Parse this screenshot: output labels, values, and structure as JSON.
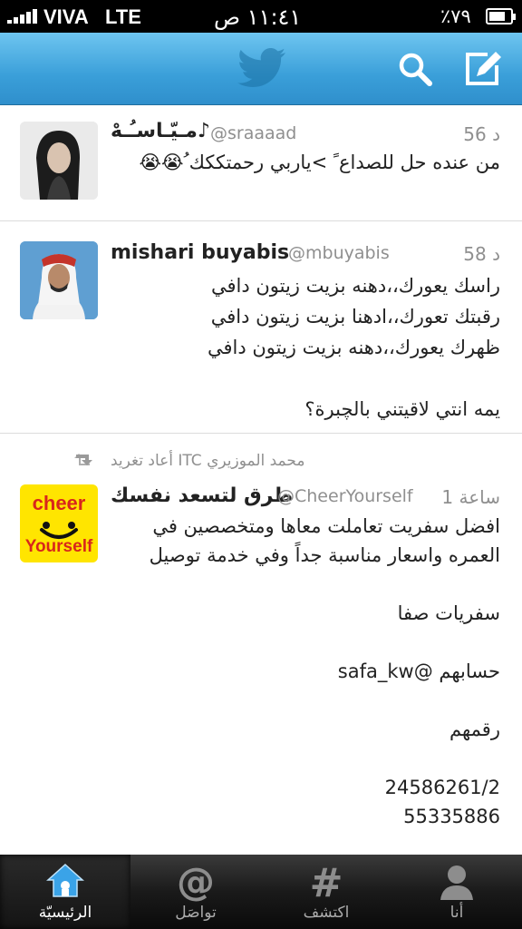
{
  "status_bar": {
    "carrier": "VIVA",
    "network": "LTE",
    "time": "١١:٤١ ص",
    "battery": "٪٧٩",
    "battery_level": 0.79
  },
  "nav": {
    "logo_icon": "twitter-bird-icon",
    "search_icon": "search-icon",
    "compose_icon": "compose-icon",
    "bar_color": "#3a9fd9"
  },
  "tweets": [
    {
      "time": "56 د",
      "name": "مـيّـاسـُـهْ♪",
      "handle": "@sraaaad",
      "text": "من عنده حل للصداع ً >ياربي رحمتككك ُ😭😭"
    },
    {
      "time": "58 د",
      "name": "mishari buyabis",
      "handle": "@mbuyabis",
      "text": "راسك يعورك،،دهنه بزيت زيتون دافي\nرقبتك تعورك،،ادهنا بزيت زيتون دافي\nظهرك يعورك،،دهنه بزيت زيتون دافي\n\nيمه انتي لاقيتني بالچبرة؟"
    },
    {
      "retweet_by": "محمد الموزيري ITC أعاد تغريد",
      "time": "1 ساعة",
      "name": "طرق لتسعد نفسك",
      "handle": "@CheerYourself",
      "avatar_text_top": "cheer",
      "avatar_text_bottom": "Yourself",
      "text": "افضل سفريت تعاملت معاها ومتخصصين في\nالعمره واسعار مناسبة جداً وفي خدمة توصيل\n\nسفريات صفا\n\nحسابهم @safa_kw\n\nرقمهم\n\n24586261/2\n55335886"
    }
  ],
  "tabs": [
    {
      "label": "الرئيسيّة",
      "icon": "home-icon",
      "active": true
    },
    {
      "label": "تواصَل",
      "icon": "at-icon",
      "active": false
    },
    {
      "label": "اكتشف",
      "icon": "hashtag-icon",
      "active": false
    },
    {
      "label": "أنا",
      "icon": "person-icon",
      "active": false
    }
  ]
}
